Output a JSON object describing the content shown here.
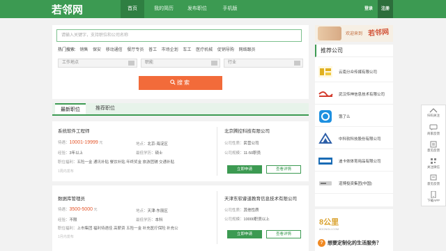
{
  "header": {
    "logo": "若邻网",
    "nav": [
      "首页",
      "我的简历",
      "发布职位",
      "手机版"
    ],
    "login": "登录",
    "register": "注册"
  },
  "search": {
    "placeholder": "请输入关键字，支持职位和公司名称",
    "hot_label": "热门搜索:",
    "hot_keywords": [
      "销售",
      "保安",
      "移动通信",
      "餐厅专员",
      "普工",
      "市场企划",
      "车工",
      "医疗机械",
      "促销导购",
      "网络跟员"
    ],
    "filters": [
      "工作地点",
      "职能",
      "行业"
    ],
    "button": "搜索"
  },
  "tabs": [
    "最新职位",
    "推荐职位"
  ],
  "jobs": [
    {
      "title": "系统软件工程师",
      "salary_label": "待遇：",
      "salary": "10001-19999",
      "salary_unit": "元",
      "location_label": "地点：",
      "location": "北京-海淀区",
      "experience_label": "经验：",
      "experience": "3年以上",
      "education_label": "最低学历：",
      "education": "硕士",
      "benefits_label": "职位福利：",
      "benefits": "五险一金 通讯补贴 餐饮补贴 年终奖金 旅游团辅 交通补贴",
      "posted": "1周内发布",
      "company": "北京腾控科技有限公司",
      "nature_label": "公司性质：",
      "nature": "民营公司",
      "size_label": "公司规模：",
      "size": "11-50职员",
      "apply": "立即申请",
      "detail": "查看详情"
    },
    {
      "title": "数据库管理员",
      "salary_label": "待遇：",
      "salary": "3500-5000",
      "salary_unit": "元",
      "location_label": "地点：",
      "location": "天津-东丽区",
      "experience_label": "经验：",
      "experience": "不限",
      "education_label": "最低学历：",
      "education": "本科",
      "benefits_label": "职位福利：",
      "benefits": "上市集团 福利待遇佳 高薪资 五险一金 补充医疗保险 补充公",
      "posted": "1月内发布",
      "company": "天津东软睿道教育信息技术有限公司",
      "nature_label": "公司性质：",
      "nature": "其他性质",
      "size_label": "公司规模：",
      "size": "10000职员以上",
      "apply": "立即申请",
      "detail": "查看详情"
    }
  ],
  "sidebar": {
    "banner_text": "欢迎来到",
    "banner_logo": "若邻网",
    "rec_title": "推荐公司",
    "companies": [
      {
        "name": "云南分众传媒有限公司",
        "color": "#e0b020"
      },
      {
        "name": "武汉传神信息技术有限公司",
        "color": "#d33a2c"
      },
      {
        "name": "饿了么",
        "color": "#1e90e0"
      },
      {
        "name": "中科软科技股份有限公司",
        "color": "#2d5fa8"
      },
      {
        "name": "迪卡侬体育用品有限公司",
        "color": "#1a6cb5"
      },
      {
        "name": "道博投资集团(中国)",
        "color": "#777777"
      }
    ],
    "promo_logo": "8公里",
    "promo_sub": "8GONGLI.COM",
    "promo_line": "想要定制化的生活服务？"
  },
  "float_bar": [
    "扫码关注",
    "商家反馈",
    "意见反馈",
    "关注微信",
    "意见反馈",
    "下载APP"
  ]
}
